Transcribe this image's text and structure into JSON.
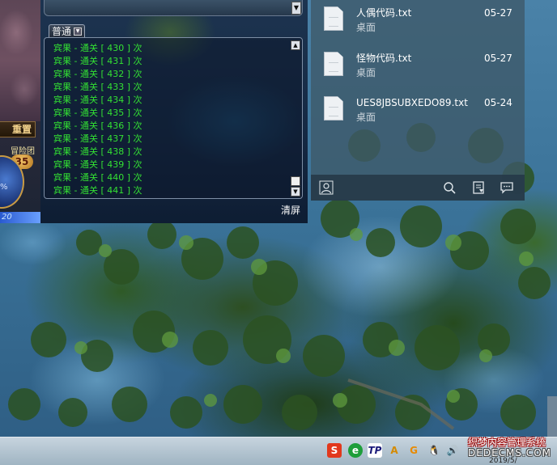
{
  "game": {
    "settings_label": "重置",
    "badge_label": "冒险团",
    "badge_value": "35",
    "orb_text": "%",
    "bottom_strip_text": "20",
    "chat": {
      "tab_label": "普通",
      "lines": [
        "宾果 - 通关 [ 430 ] 次",
        "宾果 - 通关 [ 431 ] 次",
        "宾果 - 通关 [ 432 ] 次",
        "宾果 - 通关 [ 433 ] 次",
        "宾果 - 通关 [ 434 ] 次",
        "宾果 - 通关 [ 435 ] 次",
        "宾果 - 通关 [ 436 ] 次",
        "宾果 - 通关 [ 437 ] 次",
        "宾果 - 通关 [ 438 ] 次",
        "宾果 - 通关 [ 439 ] 次",
        "宾果 - 通关 [ 440 ] 次",
        "宾果 - 通关 [ 441 ] 次"
      ],
      "text_color": "#33e033",
      "clear_label": "清屏"
    }
  },
  "files": [
    {
      "name": "人偶代码.txt",
      "location": "桌面",
      "date": "05-27"
    },
    {
      "name": "怪物代码.txt",
      "location": "桌面",
      "date": "05-27"
    },
    {
      "name": "UES8JBSUBXEDO89.txt",
      "location": "桌面",
      "date": "05-24"
    }
  ],
  "file_toolbar": {
    "icons": [
      "user-icon",
      "search-icon",
      "note-icon",
      "chat-icon"
    ]
  },
  "taskbar": {
    "tray_icons": [
      "sogou-ime-icon",
      "security-icon",
      "tp-icon",
      "font-icon",
      "g-icon",
      "qq-icon",
      "volume-icon"
    ]
  },
  "watermark": {
    "title": "织梦内容管理系统",
    "domain": "DEDECMS.COM"
  },
  "clock_fragment": "2019/5/"
}
